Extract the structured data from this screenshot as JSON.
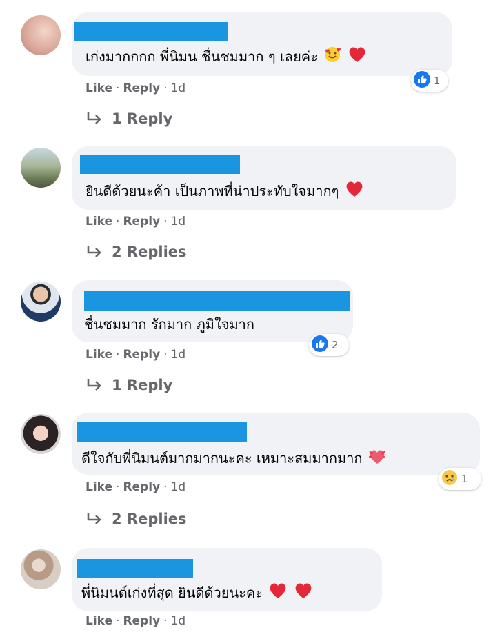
{
  "comments": [
    {
      "text": "เก่งมากกกก พี่นิมน ชื่นชมมาก ๆ เลยค่ะ",
      "emojis": [
        "smiling-face-with-hearts-icon",
        "red-heart-icon"
      ],
      "actions": {
        "like": "Like",
        "reply": "Reply",
        "time": "1d"
      },
      "reaction": {
        "icon": "like-icon",
        "count": "1"
      },
      "replies": "1 Reply"
    },
    {
      "text": "ยินดีด้วยนะค้า เป็นภาพที่น่าประทับใจมากๆ",
      "emojis": [
        "red-heart-icon"
      ],
      "actions": {
        "like": "Like",
        "reply": "Reply",
        "time": "1d"
      },
      "replies": "2 Replies"
    },
    {
      "text": "ชื่นชมมาก รักมาก ภูมิใจมาก",
      "emojis": [],
      "actions": {
        "like": "Like",
        "reply": "Reply",
        "time": "1d"
      },
      "reaction": {
        "icon": "like-icon",
        "count": "2"
      },
      "replies": "1 Reply"
    },
    {
      "text": "ดีใจกับพี่นิมนต์มากมากนะคะ เหมาะสมมากมาก",
      "emojis": [
        "heart-with-ribbon-icon"
      ],
      "actions": {
        "like": "Like",
        "reply": "Reply",
        "time": "1d"
      },
      "reaction": {
        "icon": "sad-face-icon",
        "count": "1"
      },
      "replies": "2 Replies"
    },
    {
      "text": "พี่นิมนต์เก่งที่สุด ยินดีด้วยนะคะ",
      "emojis": [
        "red-heart-icon",
        "red-heart-icon"
      ],
      "actions": {
        "like": "Like",
        "reply": "Reply",
        "time": "1d"
      }
    }
  ],
  "colors": {
    "bubble": "#f0f2f5",
    "redaction": "#1a96e0",
    "meta": "#65676b",
    "like_blue": "#1877f2"
  }
}
